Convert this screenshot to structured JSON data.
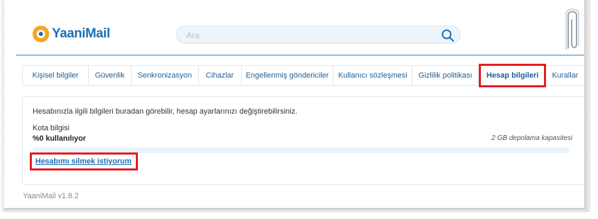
{
  "app": {
    "logo_text": "YaaniMail",
    "version": "YaaniMail v1.8.2",
    "accent_color": "#1b6fb5",
    "highlight_color": "#e51b24"
  },
  "search": {
    "placeholder": "Ara",
    "icon": "search-icon"
  },
  "tabs": [
    {
      "label": "Kişisel bilgiler"
    },
    {
      "label": "Güvenlik"
    },
    {
      "label": "Senkronizasyon"
    },
    {
      "label": "Cihazlar"
    },
    {
      "label": "Engellenmiş göndericiler"
    },
    {
      "label": "Kullanıcı sözleşmesi"
    },
    {
      "label": "Gizlilik politikası"
    },
    {
      "label": "Hesap bilgileri",
      "active": true
    },
    {
      "label": "Kurallar"
    }
  ],
  "account": {
    "intro": "Hesabınızla ilgili bilgileri buradan görebilir, hesap ayarlarınızı değiştirebilirsiniz.",
    "quota_title": "Kota bilgisi",
    "quota_usage": "%0 kullanılıyor",
    "quota_percent": 0,
    "capacity": "2 GB depolama kapasitesi",
    "delete_link": "Hesabımı silmek istiyorum"
  }
}
